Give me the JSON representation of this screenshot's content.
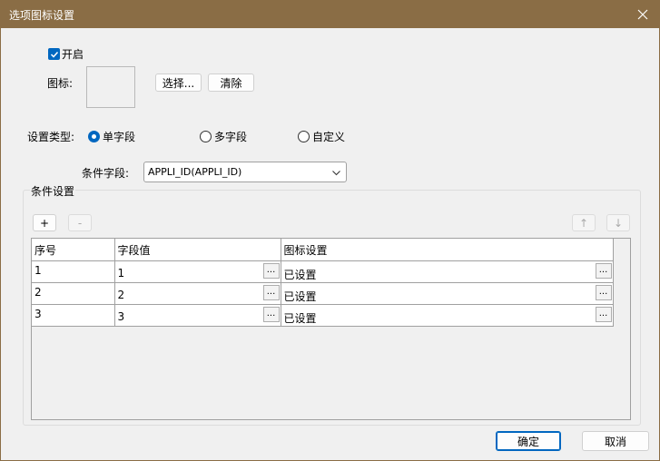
{
  "window": {
    "title": "选项图标设置"
  },
  "enable": {
    "label": "开启",
    "checked": true
  },
  "icon_row": {
    "label": "图标:",
    "select_label": "选择...",
    "clear_label": "清除"
  },
  "setting_type": {
    "label": "设置类型:",
    "options": [
      {
        "label": "单字段",
        "selected": true
      },
      {
        "label": "多字段",
        "selected": false
      },
      {
        "label": "自定义",
        "selected": false
      }
    ]
  },
  "condition_field": {
    "label": "条件字段:",
    "value": "APPLI_ID(APPLI_ID)"
  },
  "condition_group": {
    "label": "条件设置",
    "add_label": "+",
    "remove_label": "-",
    "up_label": "↑",
    "down_label": "↓",
    "columns": [
      "序号",
      "字段值",
      "图标设置"
    ],
    "rows": [
      {
        "index": "1",
        "value": "1",
        "icon": "已设置"
      },
      {
        "index": "2",
        "value": "2",
        "icon": "已设置"
      },
      {
        "index": "3",
        "value": "3",
        "icon": "已设置"
      }
    ],
    "cell_button_label": "..."
  },
  "footer": {
    "ok_label": "确定",
    "cancel_label": "取消"
  },
  "colors": {
    "titlebar": "#8a6d45",
    "accent": "#0067c0"
  }
}
